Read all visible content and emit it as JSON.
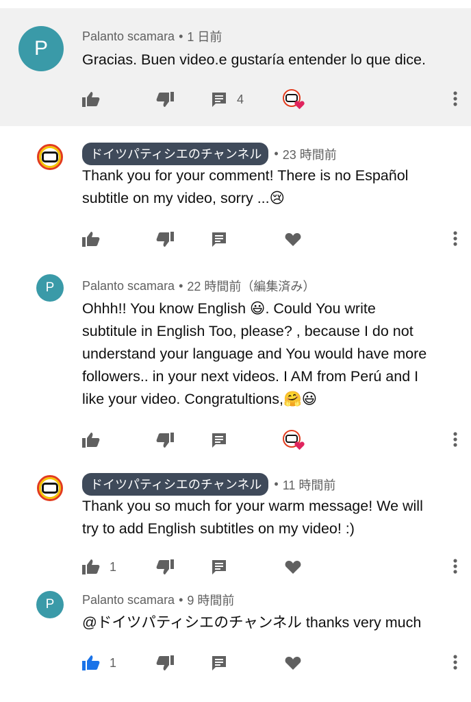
{
  "comments": [
    {
      "author": "Palanto scamara",
      "avatar_letter": "P",
      "time": "1 日前",
      "text": "Gracias. Buen video.e gustaría entender lo que dice.",
      "like_count": "",
      "reply_count": "4",
      "creator_hearted": true,
      "liked": false
    },
    {
      "author": "ドイツパティシエのチャンネル",
      "time": "23 時間前",
      "text": "Thank you for your comment! There is no Español\nsubtitle on my video, sorry ...😢",
      "like_count": "",
      "creator_hearted": false,
      "liked": false
    },
    {
      "author": "Palanto scamara",
      "avatar_letter": "P",
      "time": "22 時間前（編集済み）",
      "text": "Ohhh!! You know English 😃. Could You write\nsubtitule in English Too, please? , because I do not\nunderstand your language and You would have more\nfollowers.. in  your next videos. I AM from Perú and I\nlike your video. Congratultions,🤗😃",
      "like_count": "",
      "creator_hearted": true,
      "liked": false
    },
    {
      "author": "ドイツパティシエのチャンネル",
      "time": "11 時間前",
      "text": "Thank you so much for your warm message! We will\ntry to add English subtitles on my video! :)",
      "like_count": "1",
      "creator_hearted": false,
      "liked": false
    },
    {
      "author": "Palanto scamara",
      "avatar_letter": "P",
      "time": "9 時間前",
      "text": "@ドイツパティシエのチャンネル thanks very much",
      "like_count": "1",
      "creator_hearted": false,
      "liked": true
    }
  ],
  "colors": {
    "highlight_bg": "#f1f1f1",
    "avatar_p": "#3a9aa8",
    "chip_bg": "#3f4a5a",
    "icon_grey": "#606060",
    "liked_blue": "#1a73e8",
    "heart_red": "#e0245e"
  },
  "icons": {
    "like": "thumbs-up-icon",
    "dislike": "thumbs-down-icon",
    "reply": "comment-icon",
    "heart": "heart-icon",
    "more": "more-vert-icon"
  }
}
